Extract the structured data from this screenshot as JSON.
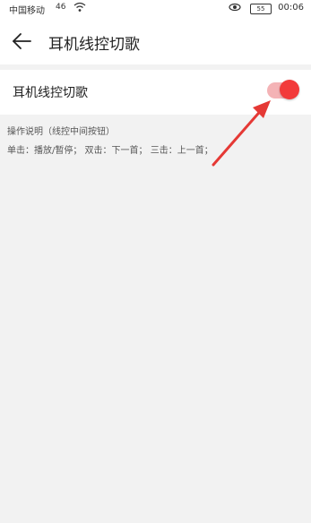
{
  "status_bar": {
    "carrier": "中国移动",
    "signal": "46",
    "battery": "55",
    "time": "00:06"
  },
  "header": {
    "title": "耳机线控切歌"
  },
  "setting": {
    "label": "耳机线控切歌",
    "toggle_on": true,
    "accent_color": "#f23a3a"
  },
  "description": {
    "title": "操作说明（线控中间按钮）",
    "text": "单击：播放/暂停；  双击：下一首；  三击：上一首；"
  },
  "icons": [
    "back-arrow-icon",
    "wifi-icon",
    "eye-icon",
    "battery-icon"
  ]
}
